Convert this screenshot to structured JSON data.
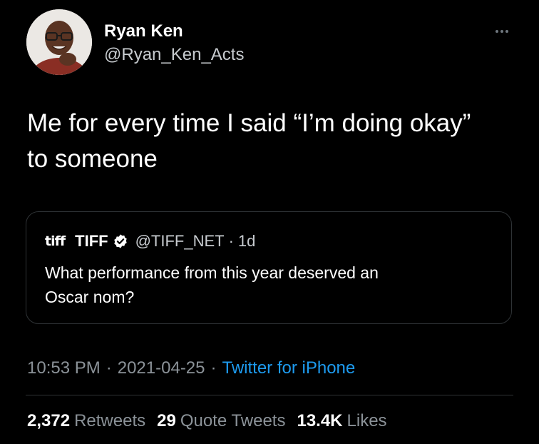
{
  "author": {
    "display_name": "Ryan Ken",
    "handle": "@Ryan_Ken_Acts"
  },
  "more_icon": "more-horizontal-icon",
  "tweet": {
    "text_line1": "Me for every time I said “I’m doing okay”",
    "text_line2": "to someone"
  },
  "quote": {
    "logo_text": "tiff",
    "name": "TIFF",
    "verified_icon": "verified-badge-icon",
    "handle": "@TIFF_NET",
    "separator": "·",
    "time": "1d",
    "text_line1": "What performance from this year deserved an",
    "text_line2": "Oscar nom?"
  },
  "meta": {
    "time": "10:53 PM",
    "date": "2021-04-25",
    "separator": "·",
    "source": "Twitter for iPhone"
  },
  "stats": {
    "retweets_count": "2,372",
    "retweets_label": "Retweets",
    "quotes_count": "29",
    "quotes_label": "Quote Tweets",
    "likes_count": "13.4K",
    "likes_label": "Likes"
  },
  "colors": {
    "background": "#000000",
    "text": "#ffffff",
    "secondary_text": "#8b9298",
    "link": "#1d9bf0",
    "border": "#2f3336"
  }
}
